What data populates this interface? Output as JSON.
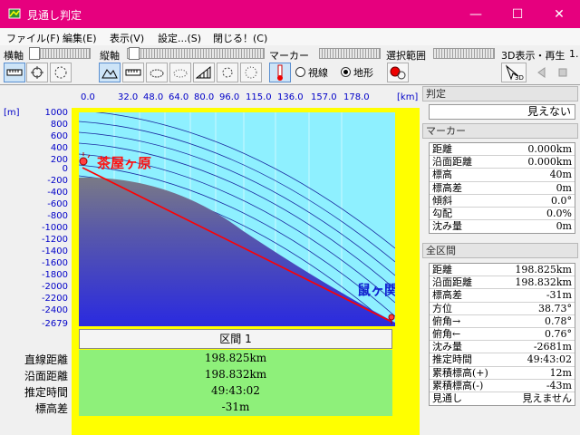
{
  "window": {
    "title": "見通し判定",
    "minimize": "—",
    "maximize": "☐",
    "close": "✕"
  },
  "menu": [
    "ファイル(F)",
    "編集(E)",
    "表示(V)",
    "設定...(S)",
    "閉じる！(C)"
  ],
  "toolbar": {
    "horizontal_label": "横軸",
    "vertical_label": "縦軸",
    "marker_label": "マーカー",
    "range_label": "選択範囲",
    "view3d_label": "3D表示・再生",
    "view3d_extra": "1.",
    "radio_line": "視線",
    "radio_terrain": "地形",
    "radio_selected": "地形",
    "btn_3d": "3D"
  },
  "plot": {
    "x_unit": "[km]",
    "y_unit": "[m]",
    "x_ticks": [
      "0.0",
      "32.0",
      "48.0",
      "64.0",
      "80.0",
      "96.0",
      "115.0",
      "136.0",
      "157.0",
      "178.0"
    ],
    "y_ticks": [
      "1000",
      "800",
      "600",
      "400",
      "200",
      "0",
      "-200",
      "-400",
      "-600",
      "-800",
      "-1000",
      "-1200",
      "-1400",
      "-1600",
      "-1800",
      "-2000",
      "-2200",
      "-2400",
      "-2679"
    ],
    "start_label": "茶屋ヶ原",
    "end_label": "鼠ヶ関",
    "colors": {
      "sky": "#8ef0ff",
      "earth_top": "#7a7a86",
      "earth_bottom": "#2a2ae0",
      "line": "#ff0000",
      "arcs": "#1a2aa0"
    }
  },
  "section": {
    "title": "区間 1",
    "rows": [
      {
        "label": "直線距離",
        "value": "198.825km"
      },
      {
        "label": "沿面距離",
        "value": "198.832km"
      },
      {
        "label": "推定時間",
        "value": "49:43:02"
      },
      {
        "label": "標高差",
        "value": "-31m"
      }
    ]
  },
  "panel": {
    "judge_head": "判定",
    "judge_value": "見えない",
    "marker_head": "マーカー",
    "marker_rows": [
      {
        "label": "距離",
        "value": "0.000km"
      },
      {
        "label": "沿面距離",
        "value": "0.000km"
      },
      {
        "label": "標高",
        "value": "40m"
      },
      {
        "label": "標高差",
        "value": "0m"
      },
      {
        "label": "傾斜",
        "value": "0.0°"
      },
      {
        "label": "勾配",
        "value": "0.0%"
      },
      {
        "label": "沈み量",
        "value": "0m"
      }
    ],
    "total_head": "全区間",
    "total_rows": [
      {
        "label": "距離",
        "value": "198.825km"
      },
      {
        "label": "沿面距離",
        "value": "198.832km"
      },
      {
        "label": "標高差",
        "value": "-31m"
      },
      {
        "label": "方位",
        "value": "38.73°"
      },
      {
        "label": "俯角→",
        "value": "0.78°"
      },
      {
        "label": "俯角←",
        "value": "0.76°"
      },
      {
        "label": "沈み量",
        "value": "-2681m"
      },
      {
        "label": "推定時間",
        "value": "49:43:02"
      },
      {
        "label": "累積標高(+)",
        "value": "12m"
      },
      {
        "label": "累積標高(-)",
        "value": "-43m"
      },
      {
        "label": "見通し",
        "value": "見えません"
      }
    ]
  }
}
